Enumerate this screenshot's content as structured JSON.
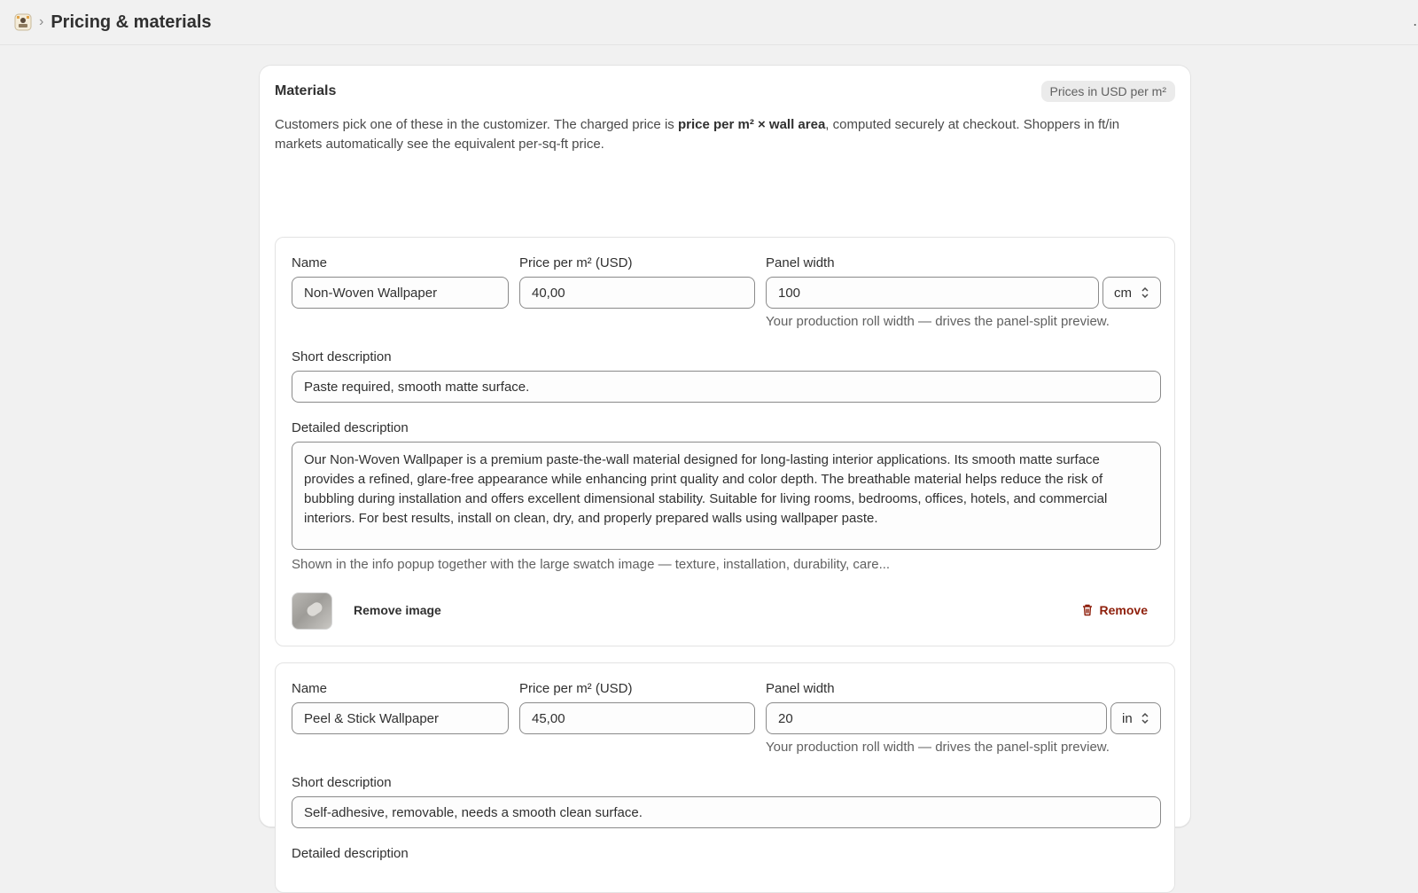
{
  "header": {
    "title": "Pricing & materials",
    "separator": "›"
  },
  "materials": {
    "title": "Materials",
    "badge": "Prices in USD per m²",
    "intro_part1": "Customers pick one of these in the customizer. The charged price is ",
    "intro_bold": "price per m² × wall area",
    "intro_part2": ", computed securely at checkout. Shoppers in ft/in markets automatically see the equivalent per-sq-ft price.",
    "labels": {
      "name": "Name",
      "price": "Price per m² (USD)",
      "panel_width": "Panel width",
      "short_description": "Short description",
      "detailed_description": "Detailed description"
    },
    "panel_width_help": "Your production roll width — drives the panel-split preview.",
    "detailed_help": "Shown in the info popup together with the large swatch image — texture, installation, durability, care...",
    "remove_image_label": "Remove image",
    "remove_label": "Remove",
    "items": [
      {
        "name": "Non-Woven Wallpaper",
        "price": "40,00",
        "panel_width": "100",
        "unit": "cm",
        "short_description": "Paste required, smooth matte surface.",
        "detailed_description": "Our Non-Woven Wallpaper is a premium paste-the-wall material designed for long-lasting interior applications. Its smooth matte surface provides a refined, glare-free appearance while enhancing print quality and color depth. The breathable material helps reduce the risk of bubbling during installation and offers excellent dimensional stability. Suitable for living rooms, bedrooms, offices, hotels, and commercial interiors. For best results, install on clean, dry, and properly prepared walls using wallpaper paste."
      },
      {
        "name": "Peel & Stick Wallpaper",
        "price": "45,00",
        "panel_width": "20",
        "unit": "in",
        "short_description": "Self-adhesive, removable, needs a smooth clean surface."
      }
    ]
  },
  "colors": {
    "accent_critical": "#8e1f0b",
    "background": "#f1f1f1",
    "card": "#ffffff"
  }
}
